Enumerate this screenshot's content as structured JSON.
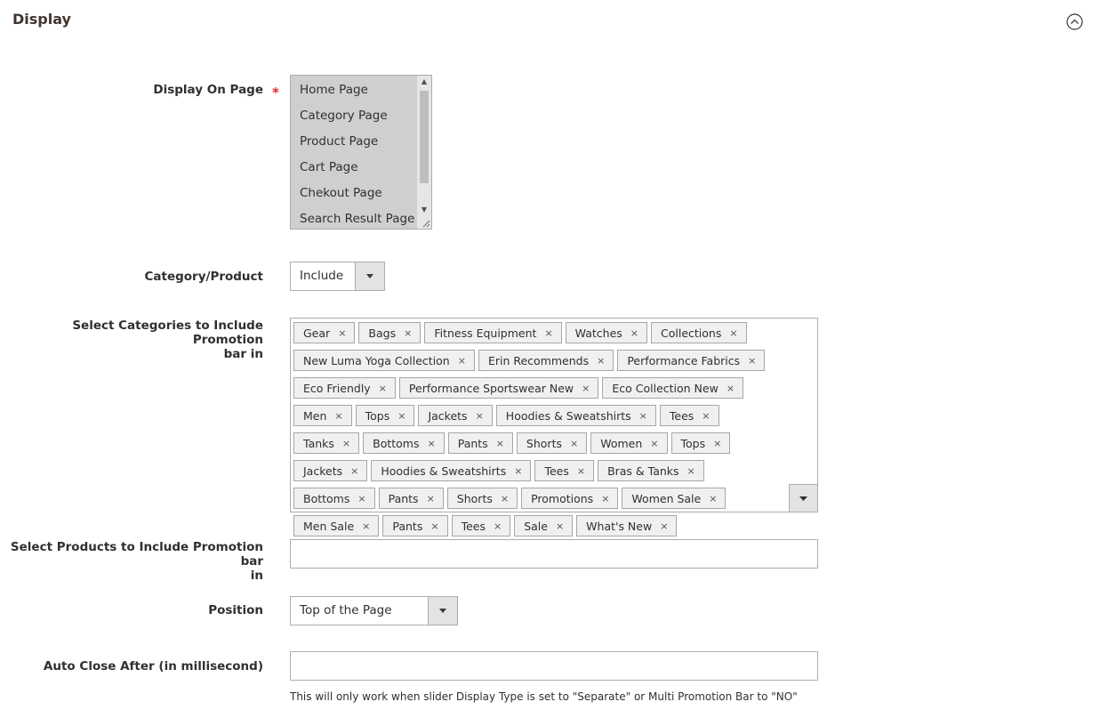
{
  "section": {
    "title": "Display",
    "collapse_icon": "chevron-up-circle-icon"
  },
  "display_on_page": {
    "label": "Display On Page",
    "required_mark": "*",
    "options": [
      "Home Page",
      "Category Page",
      "Product Page",
      "Cart Page",
      "Chekout Page",
      "Search Result Page"
    ]
  },
  "category_product": {
    "label": "Category/Product",
    "value": "Include"
  },
  "select_categories": {
    "label_line1": "Select Categories to Include Promotion",
    "label_line2": "bar in",
    "remove_glyph": "×",
    "tags": [
      "Gear",
      "Bags",
      "Fitness Equipment",
      "Watches",
      "Collections",
      "New Luma Yoga Collection",
      "Erin Recommends",
      "Performance Fabrics",
      "Eco Friendly",
      "Performance Sportswear New",
      "Eco Collection New",
      "Men",
      "Tops",
      "Jackets",
      "Hoodies & Sweatshirts",
      "Tees",
      "Tanks",
      "Bottoms",
      "Pants",
      "Shorts",
      "Women",
      "Tops",
      "Jackets",
      "Hoodies & Sweatshirts",
      "Tees",
      "Bras & Tanks",
      "Bottoms",
      "Pants",
      "Shorts",
      "Promotions",
      "Women Sale",
      "Men Sale",
      "Pants",
      "Tees",
      "Sale",
      "What's New"
    ]
  },
  "select_products": {
    "label_line1": "Select Products to Include Promotion bar",
    "label_line2": "in",
    "value": ""
  },
  "position": {
    "label": "Position",
    "value": "Top of the Page"
  },
  "auto_close": {
    "label": "Auto Close After (in millisecond)",
    "value": "",
    "note": "This will only work when slider Display Type is set to \"Separate\" or Multi Promotion Bar to \"NO\""
  },
  "colors": {
    "required": "#e22626",
    "tag_bg": "#f0f0f0",
    "tag_border": "#a6a6a6",
    "select_arrow_bg": "#e3e3e3",
    "multiselect_bg": "#cfcfcf"
  }
}
